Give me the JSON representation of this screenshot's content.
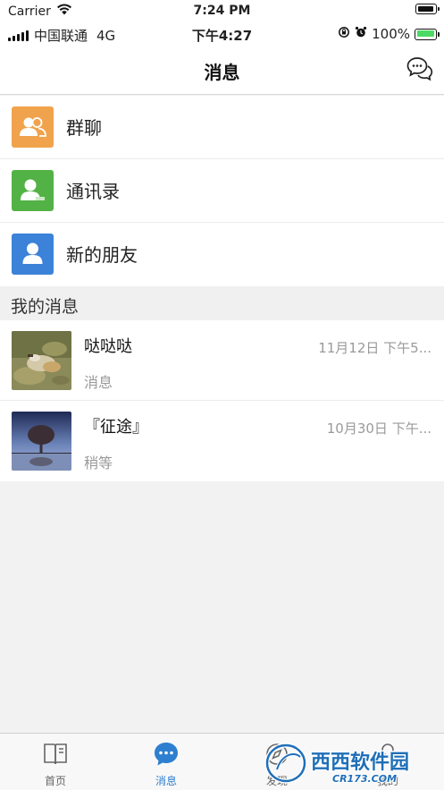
{
  "status_bar_top": {
    "carrier": "Carrier",
    "time": "7:24 PM"
  },
  "status_bar_second": {
    "carrier": "中国联通",
    "network": "4G",
    "time": "下午4:27",
    "battery": "100%"
  },
  "navbar": {
    "title": "消息",
    "right_icon": "chat-bubbles-icon"
  },
  "menu_items": [
    {
      "label": "群聊",
      "icon": "group-chat-icon",
      "color": "#f0a34c"
    },
    {
      "label": "通讯录",
      "icon": "contacts-icon",
      "color": "#53b245"
    },
    {
      "label": "新的朋友",
      "icon": "new-friend-icon",
      "color": "#3b82d8"
    }
  ],
  "section": {
    "title": "我的消息"
  },
  "conversations": [
    {
      "name": "哒哒哒",
      "time": "11月12日 下午5...",
      "preview": "消息"
    },
    {
      "name": "『征途』",
      "time": "10月30日 下午...",
      "preview": "稍等"
    }
  ],
  "tabbar": {
    "active_color": "#2f7fd0",
    "tabs": [
      {
        "label": "首页",
        "icon": "book-icon",
        "active": false
      },
      {
        "label": "消息",
        "icon": "message-bubble-icon",
        "active": true
      },
      {
        "label": "发现",
        "icon": "discover-icon",
        "active": false
      },
      {
        "label": "我的",
        "icon": "profile-icon",
        "active": false
      }
    ]
  },
  "watermark": {
    "text": "西西软件园",
    "subtext": "CR173.COM"
  }
}
